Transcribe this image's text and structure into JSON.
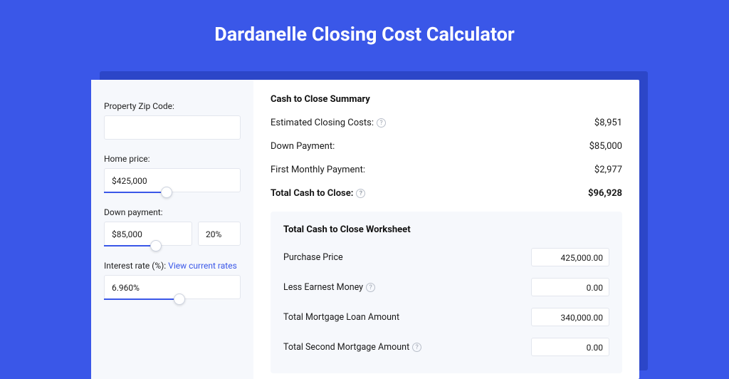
{
  "page": {
    "title": "Dardanelle Closing Cost Calculator"
  },
  "left": {
    "zip_label": "Property Zip Code:",
    "zip_value": "",
    "home_price_label": "Home price:",
    "home_price_value": "$425,000",
    "down_payment_label": "Down payment:",
    "down_payment_value": "$85,000",
    "down_payment_pct": "20%",
    "interest_label": "Interest rate (%):",
    "interest_link": "View current rates",
    "interest_value": "6.960%"
  },
  "summary": {
    "title": "Cash to Close Summary",
    "rows": [
      {
        "label": "Estimated Closing Costs:",
        "help": true,
        "value": "$8,951",
        "bold": false
      },
      {
        "label": "Down Payment:",
        "help": false,
        "value": "$85,000",
        "bold": false
      },
      {
        "label": "First Monthly Payment:",
        "help": false,
        "value": "$2,977",
        "bold": false
      },
      {
        "label": "Total Cash to Close:",
        "help": true,
        "value": "$96,928",
        "bold": true
      }
    ]
  },
  "worksheet": {
    "title": "Total Cash to Close Worksheet",
    "rows": [
      {
        "label": "Purchase Price",
        "help": false,
        "value": "425,000.00"
      },
      {
        "label": "Less Earnest Money",
        "help": true,
        "value": "0.00"
      },
      {
        "label": "Total Mortgage Loan Amount",
        "help": false,
        "value": "340,000.00"
      },
      {
        "label": "Total Second Mortgage Amount",
        "help": true,
        "value": "0.00"
      }
    ]
  }
}
